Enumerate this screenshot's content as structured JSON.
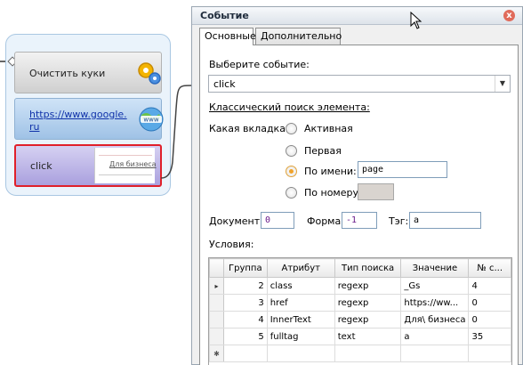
{
  "canvas": {
    "blocks": [
      {
        "label": "Очистить куки",
        "icon": "gears-icon"
      },
      {
        "label": "https://www.google.ru",
        "icon": "globe-www-icon"
      },
      {
        "label": "click",
        "preview_text": "Для бизнеса"
      }
    ],
    "icons": {
      "www_text": "www"
    }
  },
  "dialog": {
    "title": "Событие",
    "close_symbol": "x",
    "tabs": [
      {
        "label": "Основные",
        "active": true
      },
      {
        "label": "Дополнительно",
        "active": false
      }
    ],
    "event_label": "Выберите событие:",
    "event_value": "click",
    "search_section_title": "Классический поиск элемента:",
    "which_tab_label": "Какая вкладка:",
    "radio_options": [
      {
        "label": "Активная",
        "checked": false
      },
      {
        "label": "Первая",
        "checked": false
      },
      {
        "label": "По имени:",
        "checked": true,
        "value": "page"
      },
      {
        "label": "По номеру:",
        "checked": false,
        "value": ""
      }
    ],
    "document_label": "Документ:",
    "document_value": "0",
    "form_label": "Форма:",
    "form_value": "-1",
    "tag_label": "Тэг:",
    "tag_value": "a",
    "conditions_label": "Условия:",
    "grid": {
      "columns": [
        "Группа",
        "Атрибут",
        "Тип поиска",
        "Значение",
        "№ с..."
      ],
      "rows": [
        {
          "marker": "▸",
          "group": "2",
          "attribute": "class",
          "search_type": "regexp",
          "value": "_Gs",
          "number": "4"
        },
        {
          "marker": "",
          "group": "3",
          "attribute": "href",
          "search_type": "regexp",
          "value": "https://ww...",
          "number": "0"
        },
        {
          "marker": "",
          "group": "4",
          "attribute": "InnerText",
          "search_type": "regexp",
          "value": "Для\\ бизнеса",
          "number": "0"
        },
        {
          "marker": "",
          "group": "5",
          "attribute": "fulltag",
          "search_type": "text",
          "value": "a",
          "number": "35"
        }
      ],
      "new_row_marker": "✱"
    }
  },
  "colors": {
    "selected_block_border": "#e0202a",
    "radio_checked": "#f0a22a",
    "value_purple": "#6a1b8a"
  }
}
